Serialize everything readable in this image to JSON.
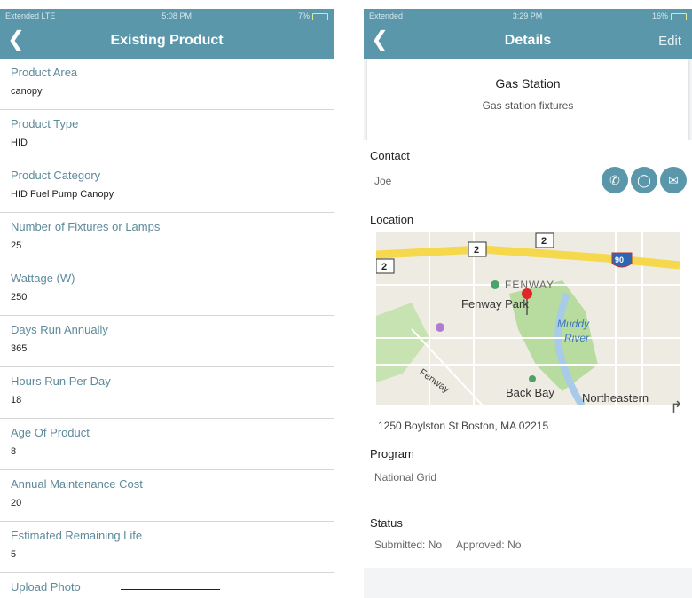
{
  "left_screen": {
    "status": {
      "carrier": "Extended",
      "network": "LTE",
      "time": "5:08 PM",
      "battery": "7%"
    },
    "nav": {
      "back_icon": "chevron-left-icon",
      "title": "Existing Product"
    },
    "fields": [
      {
        "label": "Product Area",
        "value": "canopy"
      },
      {
        "label": "Product Type",
        "value": "HID"
      },
      {
        "label": "Product Category",
        "value": "HID Fuel Pump Canopy"
      },
      {
        "label": "Number of Fixtures or Lamps",
        "value": "25"
      },
      {
        "label": "Wattage (W)",
        "value": "250"
      },
      {
        "label": "Days Run Annually",
        "value": "365"
      },
      {
        "label": "Hours Run Per Day",
        "value": "18"
      },
      {
        "label": "Age Of Product",
        "value": "8"
      },
      {
        "label": "Annual Maintenance Cost",
        "value": "20"
      },
      {
        "label": "Estimated Remaining Life",
        "value": "5"
      }
    ],
    "upload_label": "Upload Photo"
  },
  "right_screen": {
    "status": {
      "carrier": "Extended",
      "time": "3:29 PM",
      "battery": "16%"
    },
    "nav": {
      "back_icon": "chevron-left-icon",
      "title": "Details",
      "edit": "Edit"
    },
    "place": {
      "name": "Gas Station",
      "description": "Gas station fixtures"
    },
    "contact": {
      "title": "Contact",
      "name": "Joe",
      "icons": [
        "phone-icon",
        "chat-icon",
        "mail-icon"
      ]
    },
    "location": {
      "title": "Location",
      "address": "1250 Boylston St Boston, MA 02215",
      "share_icon": "share-arrow-icon",
      "map_labels": {
        "fenway": "FENWAY",
        "park": "Fenway Park",
        "muddy": "Muddy",
        "river": "River",
        "fenway_st": "Fenway",
        "back_bay": "Back Bay",
        "northeastern": "Northeastern",
        "route_2a": "2",
        "route_2b": "2",
        "route_2c": "2",
        "route_90": "90"
      }
    },
    "program": {
      "title": "Program",
      "value": "National Grid"
    },
    "status_section": {
      "title": "Status",
      "submitted": "Submitted: No",
      "approved": "Approved: No"
    }
  },
  "colors": {
    "header": "#5b97aa",
    "label": "#5d8a9b"
  }
}
